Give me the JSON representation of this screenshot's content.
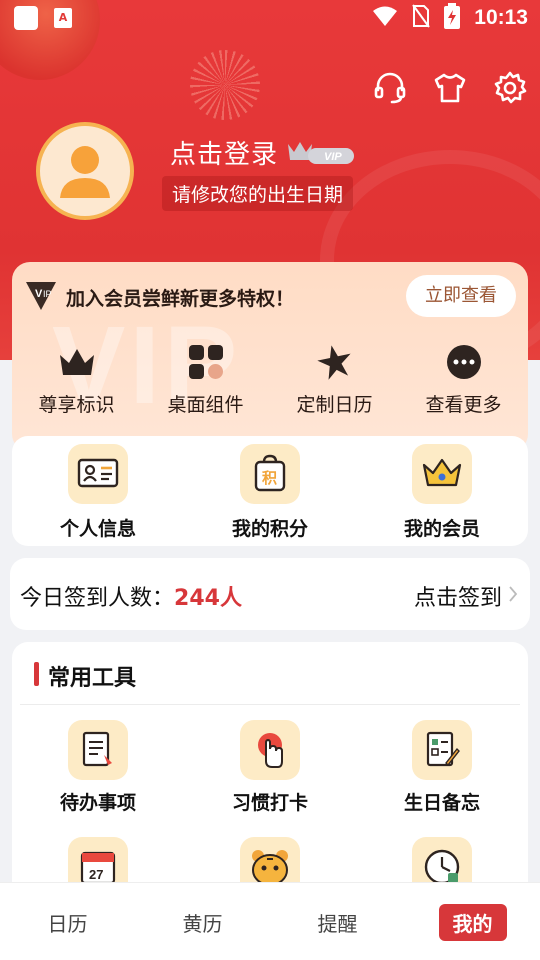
{
  "status_bar": {
    "time": "10:13",
    "app_letter": "A"
  },
  "header": {
    "icons": [
      "headset-icon",
      "tshirt-icon",
      "gear-icon"
    ],
    "login_text": "点击登录",
    "vip_tag": "VIP",
    "birthday_hint": "请修改您的出生日期"
  },
  "vip_card": {
    "title": "加入会员尝鲜新更多特权！",
    "button": "立即查看",
    "watermark": "VIP",
    "features": [
      {
        "label": "尊享标识",
        "icon": "crown-icon"
      },
      {
        "label": "桌面组件",
        "icon": "widgets-icon"
      },
      {
        "label": "定制日历",
        "icon": "star-icon"
      },
      {
        "label": "查看更多",
        "icon": "more-icon"
      }
    ]
  },
  "quick": [
    {
      "label": "个人信息",
      "icon": "id-card-icon"
    },
    {
      "label": "我的积分",
      "icon": "points-bag-icon",
      "glyph": "积"
    },
    {
      "label": "我的会员",
      "icon": "member-crown-icon"
    }
  ],
  "checkin": {
    "label": "今日签到人数：",
    "count": "244人",
    "action": "点击签到"
  },
  "tools": {
    "title": "常用工具",
    "items": [
      {
        "label": "待办事项",
        "icon": "todo-icon"
      },
      {
        "label": "习惯打卡",
        "icon": "habit-icon"
      },
      {
        "label": "生日备忘",
        "icon": "birthday-memo-icon"
      },
      {
        "label": "",
        "icon": "calendar-icon",
        "glyph": "27"
      },
      {
        "label": "",
        "icon": "tiger-icon"
      },
      {
        "label": "",
        "icon": "clock-icon"
      }
    ]
  },
  "tabs": [
    "日历",
    "黄历",
    "提醒",
    "我的"
  ],
  "colors": {
    "brand_red": "#e03333",
    "accent_red": "#d7373a",
    "vip_peach": "#ffdcc5",
    "gold": "#f6b351"
  }
}
